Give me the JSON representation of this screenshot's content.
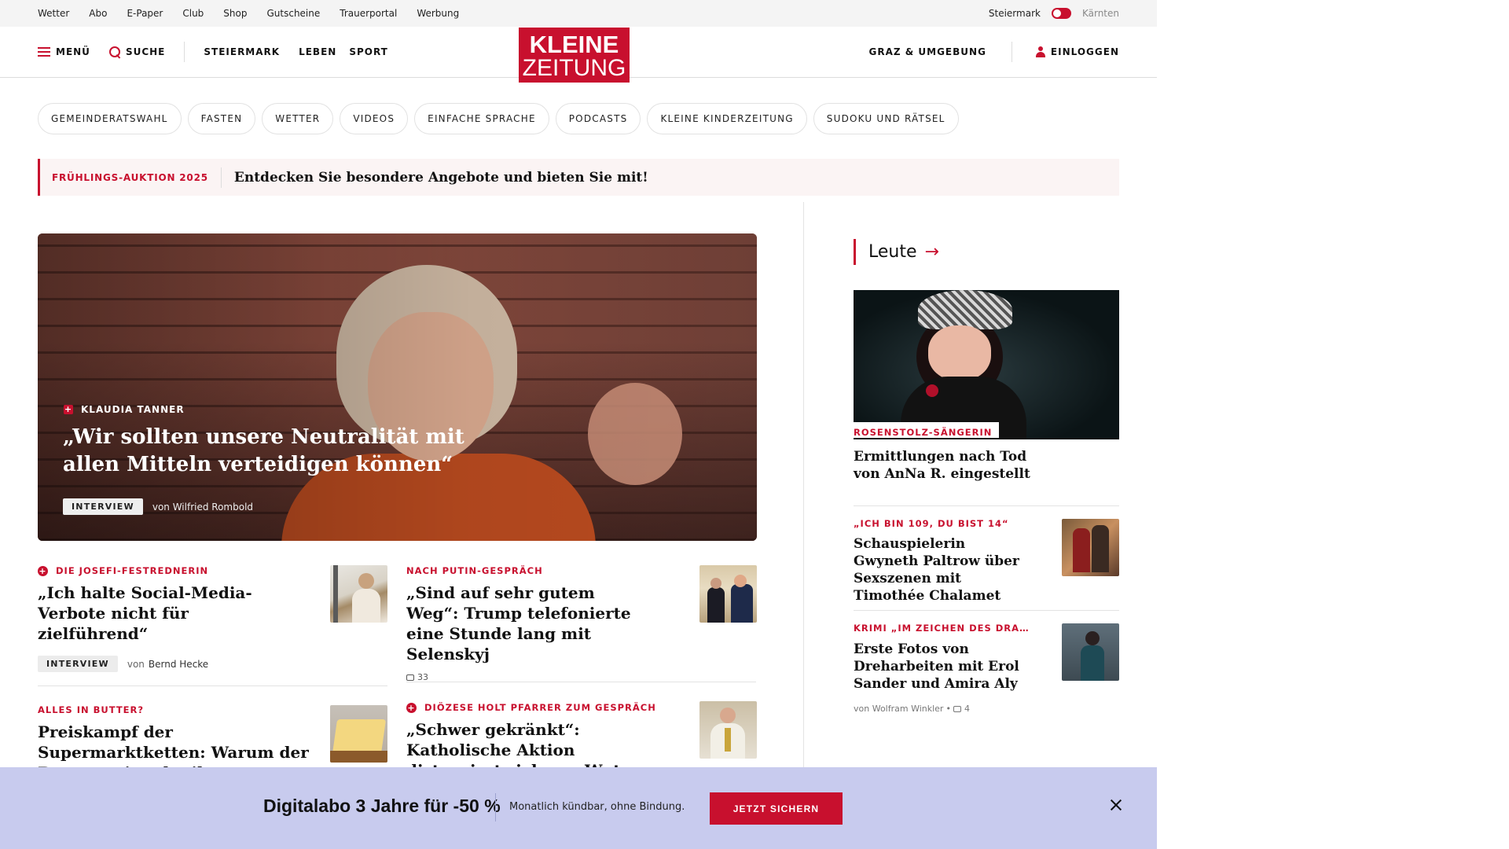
{
  "utility": {
    "links": [
      "Wetter",
      "Abo",
      "E-Paper",
      "Club",
      "Shop",
      "Gutscheine",
      "Trauerportal",
      "Werbung"
    ],
    "region_active": "Steiermark",
    "region_other": "Kärnten"
  },
  "header": {
    "menu": "MENÜ",
    "search": "SUCHE",
    "nav": [
      "STEIERMARK",
      "LEBEN",
      "SPORT"
    ],
    "logo_line1": "KLEINE",
    "logo_line2": "ZEITUNG",
    "local": "GRAZ & UMGEBUNG",
    "login": "EINLOGGEN"
  },
  "pills": [
    "GEMEINDERATSWAHL",
    "FASTEN",
    "WETTER",
    "VIDEOS",
    "EINFACHE SPRACHE",
    "PODCASTS",
    "KLEINE KINDERZEITUNG",
    "SUDOKU UND RÄTSEL"
  ],
  "promo": {
    "kicker": "FRÜHLINGS-AUKTION 2025",
    "text": "Entdecken Sie besondere Angebote und bieten Sie mit!"
  },
  "hero": {
    "kicker": "KLAUDIA TANNER",
    "title": "„Wir sollten unsere Neutralität mit allen Mitteln verteidigen können“",
    "tag": "INTERVIEW",
    "byline": "von Wilfried Rombold"
  },
  "articles": {
    "a1": {
      "kicker": "DIE JOSEFI-FESTREDNERIN",
      "title": "„Ich halte Social-Media-Verbote nicht für zielführend“",
      "tag": "INTERVIEW",
      "byline_prefix": "von",
      "author": "Bernd Hecke"
    },
    "a2": {
      "kicker": "NACH PUTIN-GESPRÄCH",
      "title": "„Sind auf sehr gutem Weg“: Trump telefonierte eine Stunde lang mit Selenskyj",
      "comments": "33"
    },
    "a3": {
      "kicker": "ALLES IN BUTTER?",
      "title": "Preiskampf der Supermarktketten: Warum der Butterpreis schmilzt"
    },
    "a4": {
      "kicker": "DIÖZESE HOLT PFARRER ZUM GESPRÄCH",
      "title": "„Schwer gekränkt“: Katholische Aktion distanziert sich von Wut-Predigt gegen Pühringer"
    }
  },
  "sidebar": {
    "section": "Leute",
    "lead": {
      "kicker": "ROSENSTOLZ-SÄNGERIN",
      "title": "Ermittlungen nach Tod von AnNa R. eingestellt"
    },
    "item1": {
      "kicker": "„ICH BIN 109, DU BIST 14“",
      "title": "Schauspielerin Gwyneth Paltrow über Sexszenen mit Timothée Chalamet"
    },
    "item2": {
      "kicker": "KRIMI „IM ZEICHEN DES DRA…",
      "title": "Erste Fotos von Dreharbeiten mit Erol Sander und Amira Aly",
      "author": "von Wolfram Winkler",
      "sep": "•",
      "comments": "4"
    }
  },
  "subscription": {
    "headline": "Digitalabo 3 Jahre für -50 %",
    "sub": "Monatlich kündbar, ohne Bindung.",
    "cta": "JETZT SICHERN"
  },
  "colors": {
    "brand_red": "#c8102e",
    "banner_bg": "#c8cbee",
    "promo_bg": "#fbf4f4"
  },
  "icons": [
    "hamburger-icon",
    "search-icon",
    "user-icon",
    "arrow-right-icon",
    "plus-icon",
    "comment-icon",
    "close-icon",
    "toggle-switch"
  ]
}
